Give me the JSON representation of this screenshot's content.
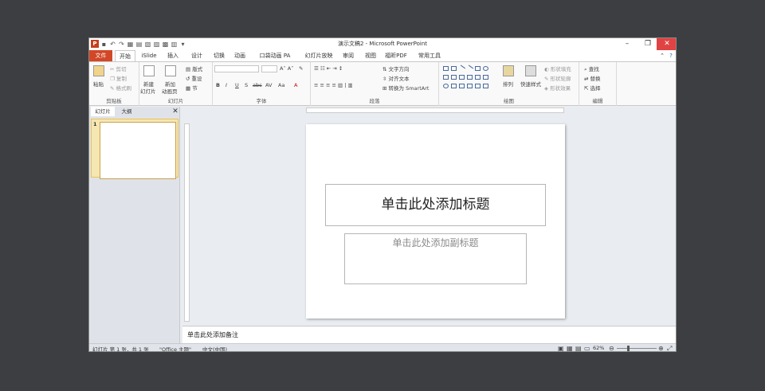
{
  "window": {
    "title": "演示文稿2 - Microsoft PowerPoint",
    "logo": "P"
  },
  "qat": [
    "save-icon",
    "undo-icon",
    "redo-icon"
  ],
  "tabs": [
    "文件",
    "开始",
    "iSlide",
    "插入",
    "设计",
    "切换",
    "动画",
    "口袋动画 PA",
    "幻灯片放映",
    "审阅",
    "视图",
    "福昕PDF",
    "常用工具"
  ],
  "ribbon": {
    "clipboard": {
      "paste": "粘贴",
      "cut": "剪切",
      "copy": "复制",
      "format_painter": "格式刷",
      "label": "剪贴板"
    },
    "slides": {
      "new_slide": "新建",
      "new_slide2": "幻灯片",
      "new_anim": "新加",
      "new_anim2": "动画页",
      "layout": "版式",
      "reset": "重设",
      "section": "节",
      "label": "幻灯片"
    },
    "font": {
      "label": "字体",
      "bold": "B",
      "italic": "I",
      "underline": "U",
      "strike": "S",
      "shadow": "abc",
      "spacing": "AV",
      "case": "Aa",
      "color": "A"
    },
    "paragraph": {
      "label": "段落",
      "text_direction": "文字方向",
      "align_text": "对齐文本",
      "smartart": "转换为 SmartArt"
    },
    "drawing": {
      "label": "绘图",
      "arrange": "排列",
      "quick_styles": "快速样式",
      "shape_fill": "形状填充",
      "shape_outline": "形状轮廓",
      "shape_effects": "形状效果"
    },
    "editing": {
      "label": "编辑",
      "find": "查找",
      "replace": "替换",
      "select": "选择"
    }
  },
  "left_pane": {
    "tab_slides": "幻灯片",
    "tab_outline": "大纲",
    "slide_number": "1"
  },
  "slide": {
    "title_placeholder": "单击此处添加标题",
    "subtitle_placeholder": "单击此处添加副标题"
  },
  "notes": {
    "placeholder": "单击此处添加备注"
  },
  "status": {
    "slide_info": "幻灯片 第 1 张，共 1 张",
    "theme": "\"Office 主题\"",
    "language": "中文(中国)",
    "zoom": "62%"
  }
}
